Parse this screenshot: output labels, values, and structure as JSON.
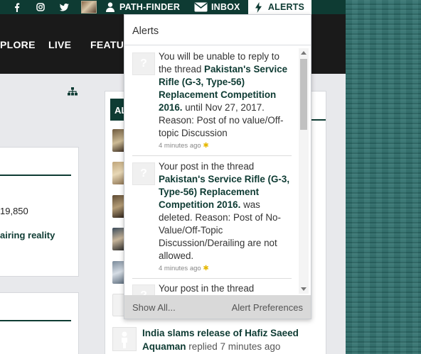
{
  "topbar": {
    "social": [
      "facebook-icon",
      "instagram-icon",
      "twitter-icon"
    ],
    "user_label": "PATH-FINDER",
    "inbox_label": "INBOX",
    "alerts_label": "ALERTS"
  },
  "nav": {
    "items": [
      "PLORE",
      "LIVE",
      "FEATU"
    ]
  },
  "left_panel": {
    "count_text": "19,850",
    "link_text": "airing reality"
  },
  "sidebar": {
    "header_text": "AL"
  },
  "alerts": {
    "title": "Alerts",
    "items": [
      {
        "pre": "You will be unable to reply to the thread ",
        "thread": "Pakistan's Service Rifle (G-3, Type-56) Replacement Competition 2016.",
        "post": " until Nov 27, 2017. Reason: Post of no value/Off-topic Discussion",
        "time": "4 minutes ago"
      },
      {
        "pre": "Your post in the thread ",
        "thread": "Pakistan's Service Rifle (G-3, Type-56) Replacement Competition 2016.",
        "post": " was deleted. Reason: Post of No-Value/Off-Topic Discussion/Derailing are not allowed.",
        "time": "4 minutes ago"
      },
      {
        "pre": "Your post in the thread",
        "thread": "",
        "post": "",
        "time": ""
      }
    ],
    "show_all": "Show All...",
    "preferences": "Alert Preferences"
  },
  "thread_row": {
    "title": "India slams release of Hafiz Saeed",
    "user": "Aquaman",
    "meta": " replied 7 minutes ago"
  },
  "colors": {
    "brand_dark_green": "#0e3b33",
    "navbar": "#1a1a1a",
    "background_teal": "#2f6f6c"
  }
}
